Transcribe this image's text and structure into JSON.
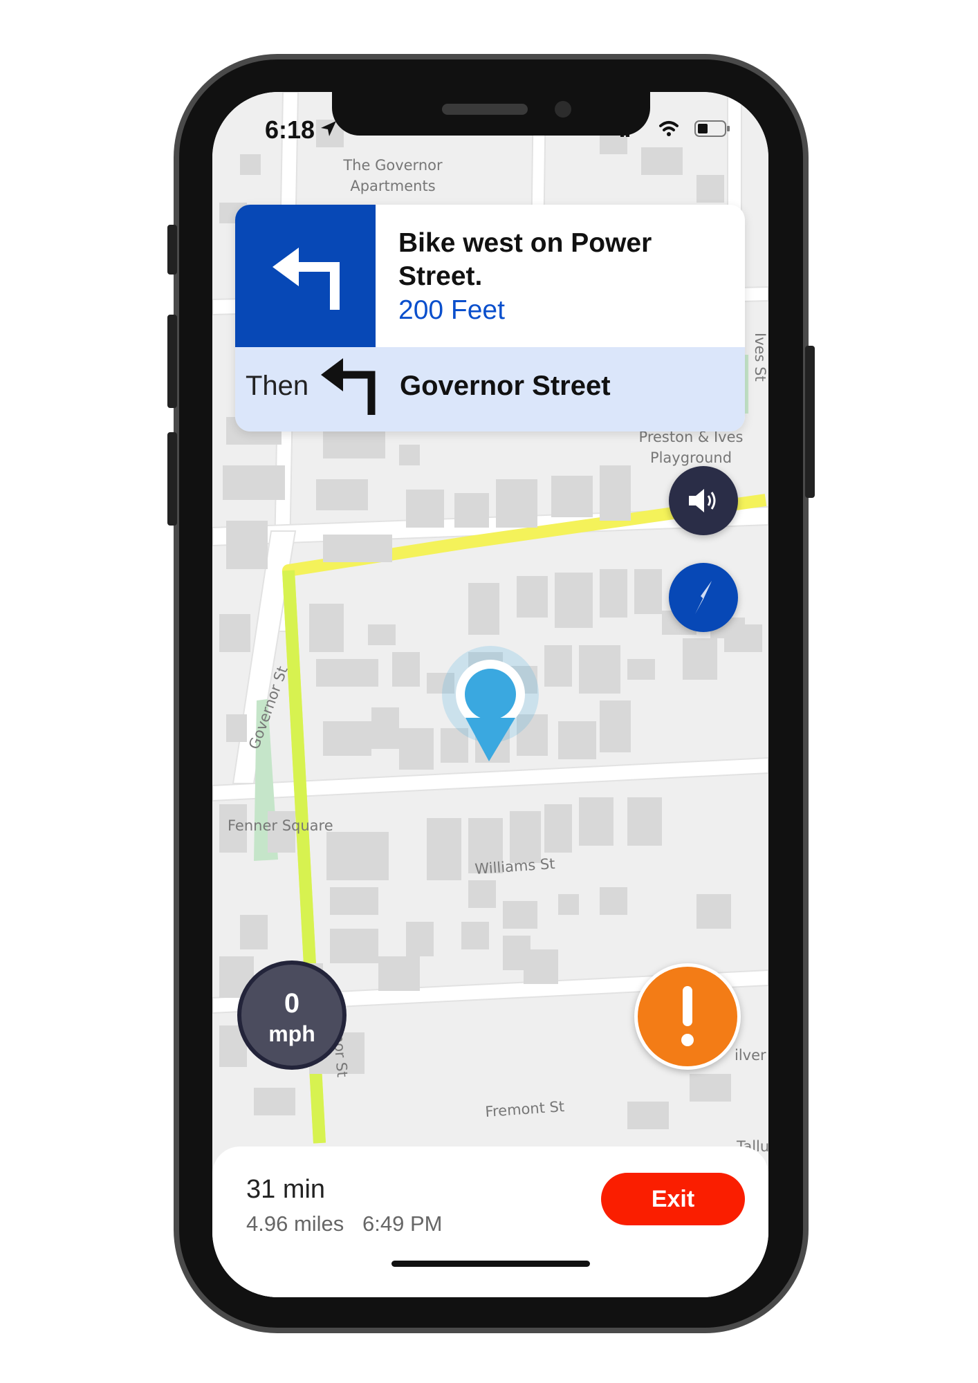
{
  "status_bar": {
    "time": "6:18"
  },
  "map": {
    "labels": {
      "governor_apartments_1": "The Governor",
      "governor_apartments_2": "Apartments",
      "ives_st": "Ives St",
      "preston_ives_1": "Preston & Ives",
      "preston_ives_2": "Playground",
      "governor_st_upper": "Governor St",
      "fenner_square": "Fenner Square",
      "williams_st": "Williams St",
      "governor_st_lower": "Governor St",
      "silver_partial": "ilver",
      "fremont_st": "Fremont St",
      "tallu_partial": "Tallu"
    }
  },
  "navigation": {
    "instruction": "Bike west on Power Street.",
    "distance": "200 Feet",
    "then_label": "Then",
    "then_street": "Governor Street"
  },
  "speed": {
    "value": "0",
    "unit": "mph"
  },
  "trip": {
    "duration": "31 min",
    "distance": "4.96 miles",
    "arrival": "6:49 PM",
    "exit_label": "Exit"
  },
  "colors": {
    "turn_box": "#0748b6",
    "distance_text": "#0a4fcc",
    "then_bar": "#dbe6fa",
    "route": "#f4f25a",
    "exit": "#fa1e00",
    "alert": "#f37c16",
    "location_pin": "#3aa8e0"
  },
  "icons": [
    "location-arrow-icon",
    "signal-icon",
    "wifi-icon",
    "battery-icon",
    "turn-left-icon",
    "then-turn-left-icon",
    "volume-icon",
    "compass-icon",
    "alert-icon",
    "location-pin-icon"
  ]
}
